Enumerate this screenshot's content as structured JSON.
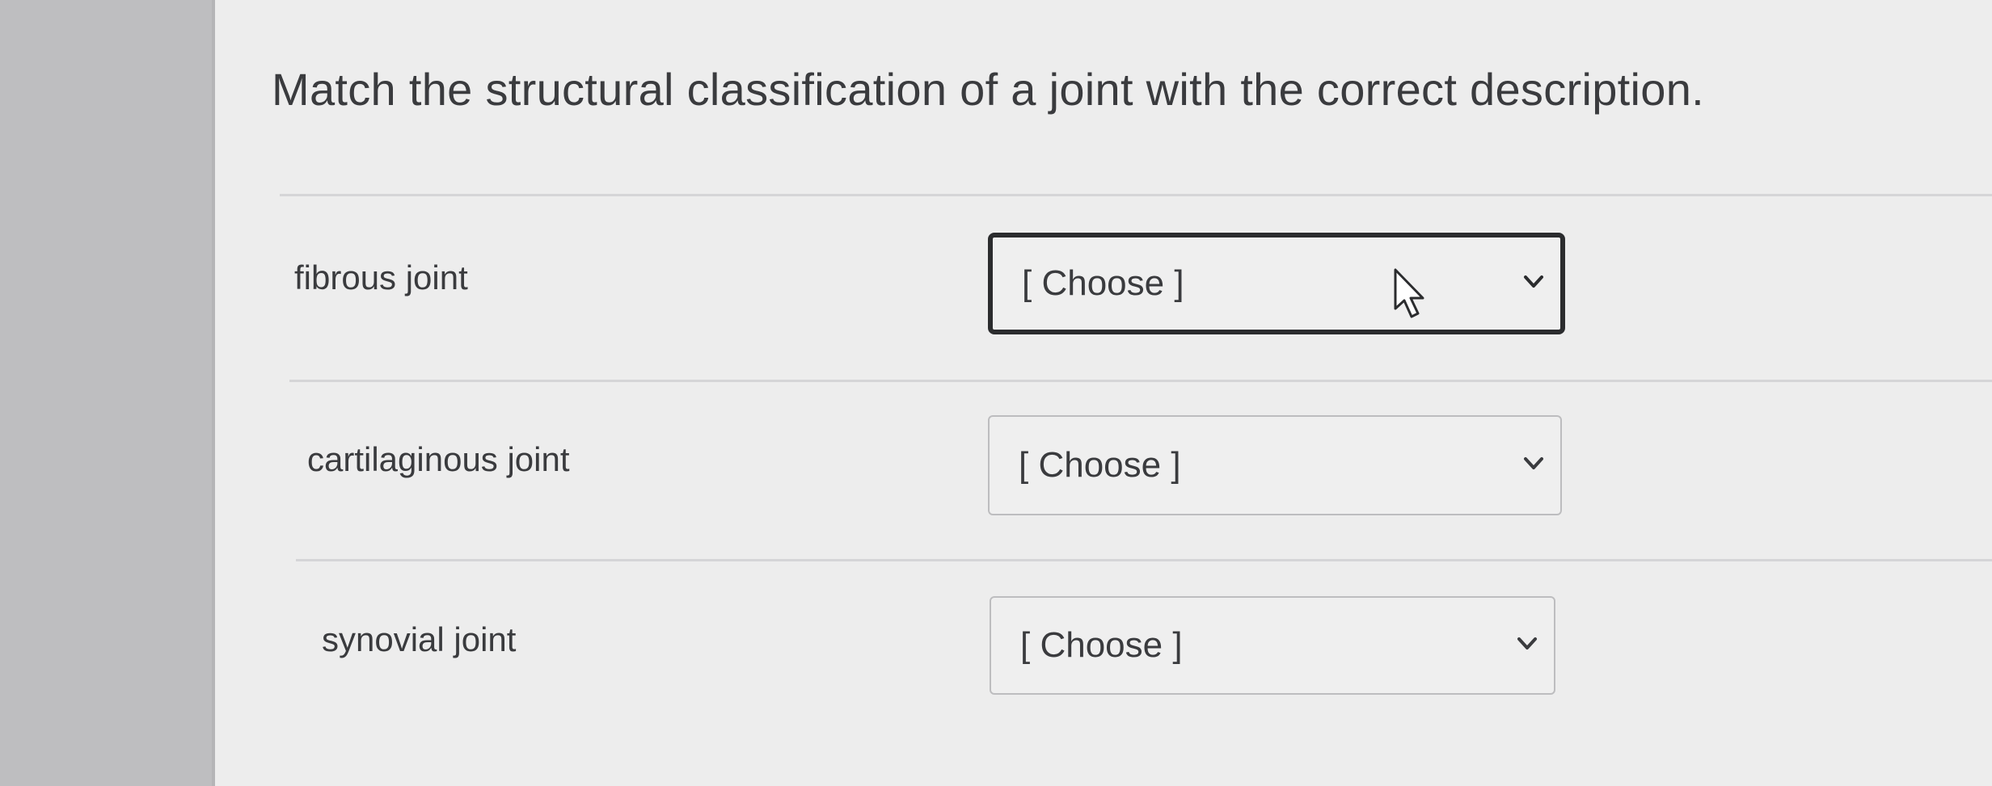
{
  "question": {
    "prompt": "Match the structural classification of a joint with the correct description."
  },
  "rows": [
    {
      "label": "fibrous joint",
      "selected": "[ Choose ]"
    },
    {
      "label": "cartilaginous joint",
      "selected": "[ Choose ]"
    },
    {
      "label": "synovial joint",
      "selected": "[ Choose ]"
    }
  ],
  "icons": {
    "dropdown": "chevron-down-icon",
    "pointer": "mouse-cursor-icon"
  },
  "colors": {
    "text": "#3a3b3e",
    "focus_border": "#2b2c2e",
    "border": "#bdbdbf",
    "card_bg": "#ededed"
  }
}
